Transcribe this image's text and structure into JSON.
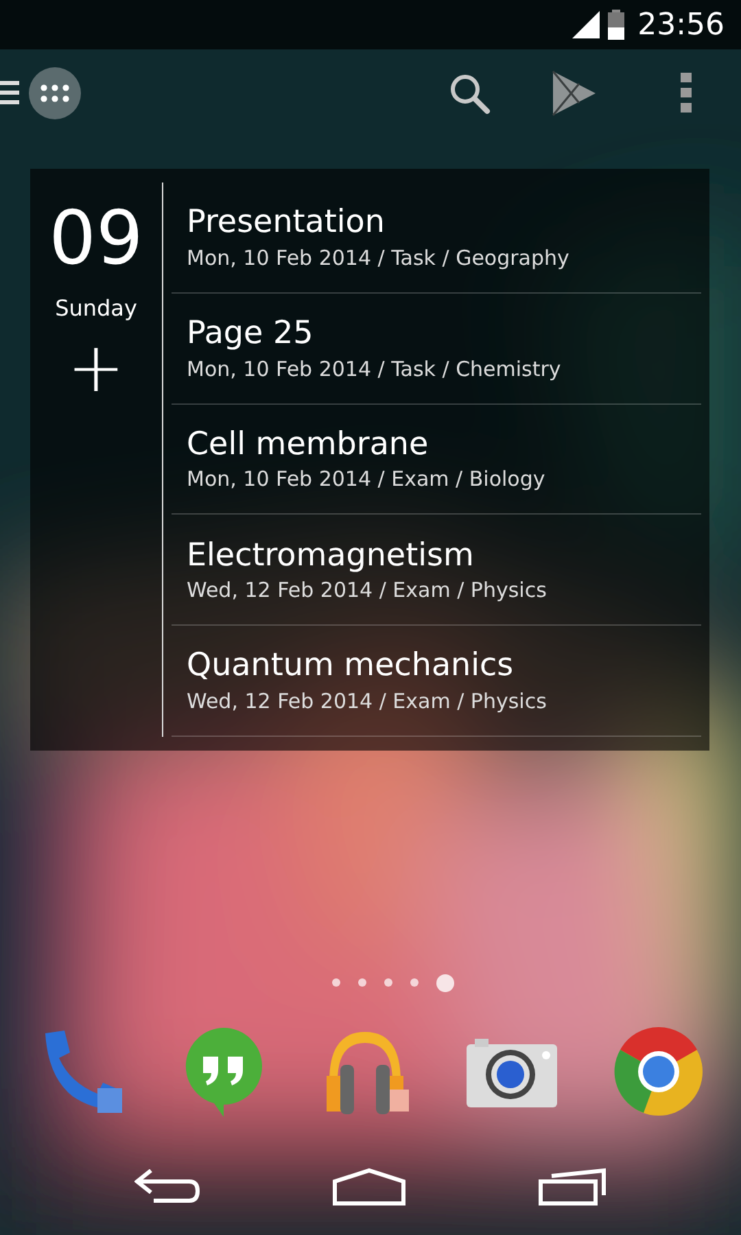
{
  "status_bar": {
    "time": "23:56"
  },
  "widget": {
    "day": "09",
    "weekday": "Sunday",
    "add": "+",
    "items": [
      {
        "title": "Presentation",
        "subtitle": "Mon, 10 Feb 2014 / Task / Geography"
      },
      {
        "title": "Page 25",
        "subtitle": "Mon, 10 Feb 2014 / Task / Chemistry"
      },
      {
        "title": "Cell membrane",
        "subtitle": "Mon, 10 Feb 2014 / Exam / Biology"
      },
      {
        "title": "Electromagnetism",
        "subtitle": "Wed, 12 Feb 2014 / Exam / Physics"
      },
      {
        "title": "Quantum mechanics",
        "subtitle": "Wed, 12 Feb 2014 / Exam / Physics"
      }
    ]
  },
  "page_indicator": [
    {
      "selected": false
    },
    {
      "selected": false
    },
    {
      "selected": false
    },
    {
      "selected": false
    },
    {
      "selected": true
    }
  ]
}
